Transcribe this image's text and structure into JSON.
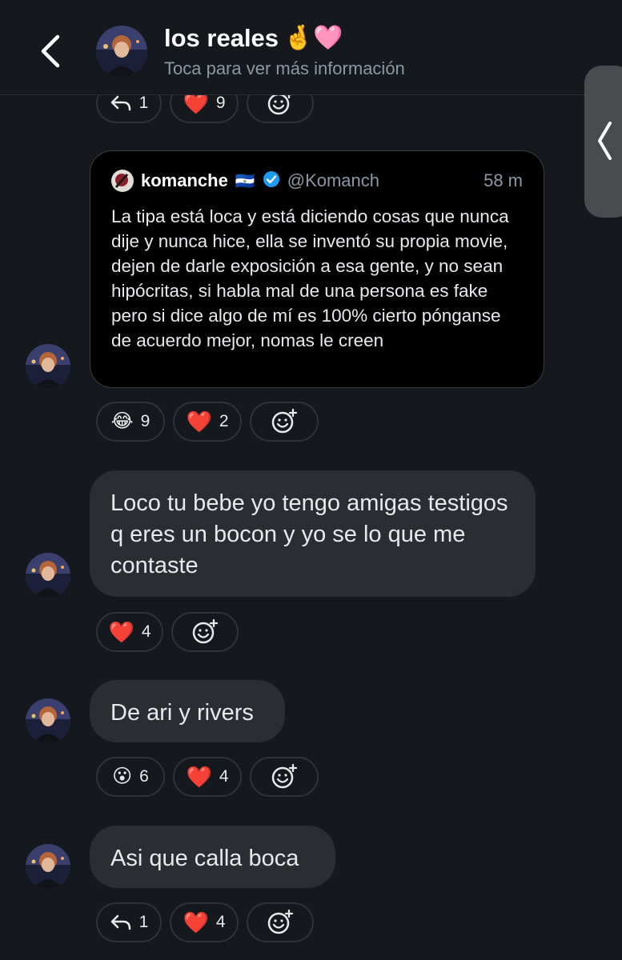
{
  "header": {
    "title": "los reales",
    "title_emojis": "🤞🩷",
    "subtitle": "Toca para ver más información"
  },
  "top_reactions": {
    "reply_count": "1",
    "heart_count": "9"
  },
  "quoted_post": {
    "author_name": "komanche",
    "flag": "🇸🇻",
    "handle": "@Komanch",
    "time": "58 m",
    "text": "La tipa está loca y está diciendo cosas que nunca dije y nunca hice, ella se inventó su propia movie, dejen de darle exposición a esa gente, y no sean hipócritas, si habla mal de una persona es fake pero si dice algo de mí es 100% cierto pónganse de acuerdo mejor, nomas le creen",
    "reactions": {
      "laugh_emoji": "😂",
      "laugh_count": "9",
      "heart_count": "2"
    }
  },
  "messages": [
    {
      "text": "Loco tu bebe yo tengo amigas testigos q eres un bocon y yo se lo que me contaste",
      "heart_count": "4"
    },
    {
      "text": "De ari y rivers",
      "wow_emoji": "😮",
      "wow_count": "6",
      "heart_count": "4"
    },
    {
      "text": "Asi que calla boca",
      "reply_count": "1",
      "heart_count": "4"
    }
  ],
  "icons": {
    "heart": "❤️",
    "back": "chevron-left-icon",
    "add_reaction": "add-reaction-icon",
    "reply": "reply-icon"
  },
  "colors": {
    "background": "#15181d",
    "bubble": "#2a2d32",
    "heart": "#f2163e",
    "verified": "#1d9bf0",
    "muted": "#8b98a5"
  }
}
